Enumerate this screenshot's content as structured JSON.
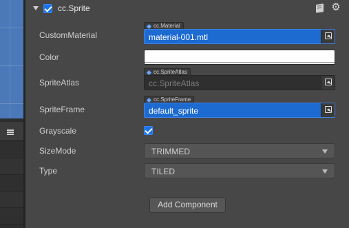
{
  "component": {
    "title": "cc.Sprite",
    "enabled": true
  },
  "properties": {
    "custom_material": {
      "label": "CustomMaterial",
      "type_tag": "cc.Material",
      "value": "material-001.mtl"
    },
    "color": {
      "label": "Color",
      "value": "#ffffff"
    },
    "sprite_atlas": {
      "label": "SpriteAtlas",
      "type_tag": "cc.SpriteAtlas",
      "placeholder": "cc.SpriteAtlas"
    },
    "sprite_frame": {
      "label": "SpriteFrame",
      "type_tag": "cc.SpriteFrame",
      "value": "default_sprite"
    },
    "grayscale": {
      "label": "Grayscale",
      "checked": true
    },
    "size_mode": {
      "label": "SizeMode",
      "value": "TRIMMED"
    },
    "type": {
      "label": "Type",
      "value": "TILED"
    }
  },
  "add_component_label": "Add Component",
  "icons": {
    "book": "book-icon",
    "gear": "gear-icon",
    "locate": "locate-icon",
    "menu": "hamburger-icon"
  },
  "colors": {
    "accent": "#1d6ad1",
    "panel": "#474747"
  }
}
